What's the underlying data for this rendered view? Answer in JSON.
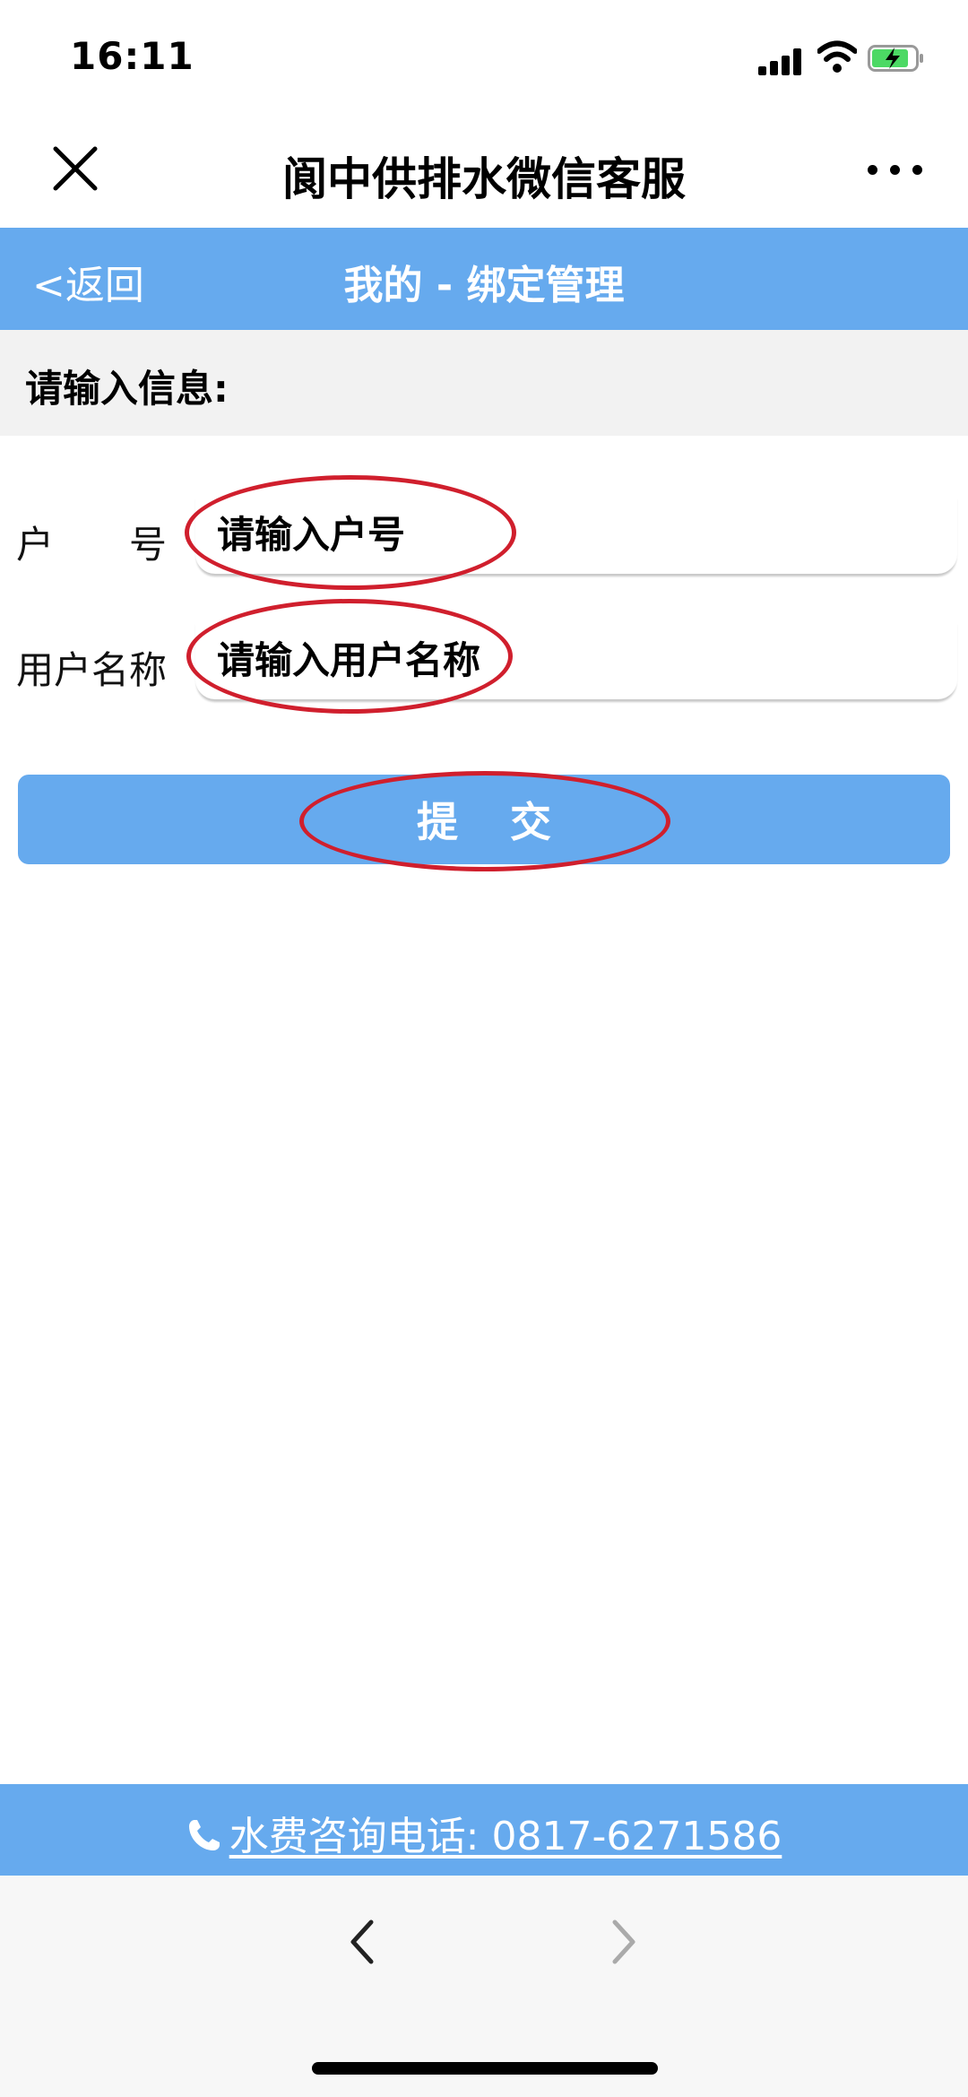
{
  "status_bar": {
    "time": "16:11"
  },
  "title_bar": {
    "title": "阆中供排水微信客服"
  },
  "header": {
    "back_label": "<返回",
    "title": "我的 - 绑定管理"
  },
  "section": {
    "label": "请输入信息:"
  },
  "form": {
    "account": {
      "label": "户　　号",
      "placeholder": "请输入户号",
      "value": ""
    },
    "username": {
      "label": "用户名称",
      "placeholder": "请输入用户名称",
      "value": ""
    },
    "submit_label": "提交"
  },
  "footer": {
    "hotline": "水费咨询电话: 0817-6271586"
  },
  "colors": {
    "accent": "#66aaee",
    "annotation_red": "#d01f2d",
    "section_bg": "#f2f2f2"
  },
  "icons": [
    "close-icon",
    "more-icon",
    "phone-icon",
    "chevron-left-icon",
    "chevron-right-icon",
    "signal-icon",
    "wifi-icon",
    "battery-icon"
  ]
}
